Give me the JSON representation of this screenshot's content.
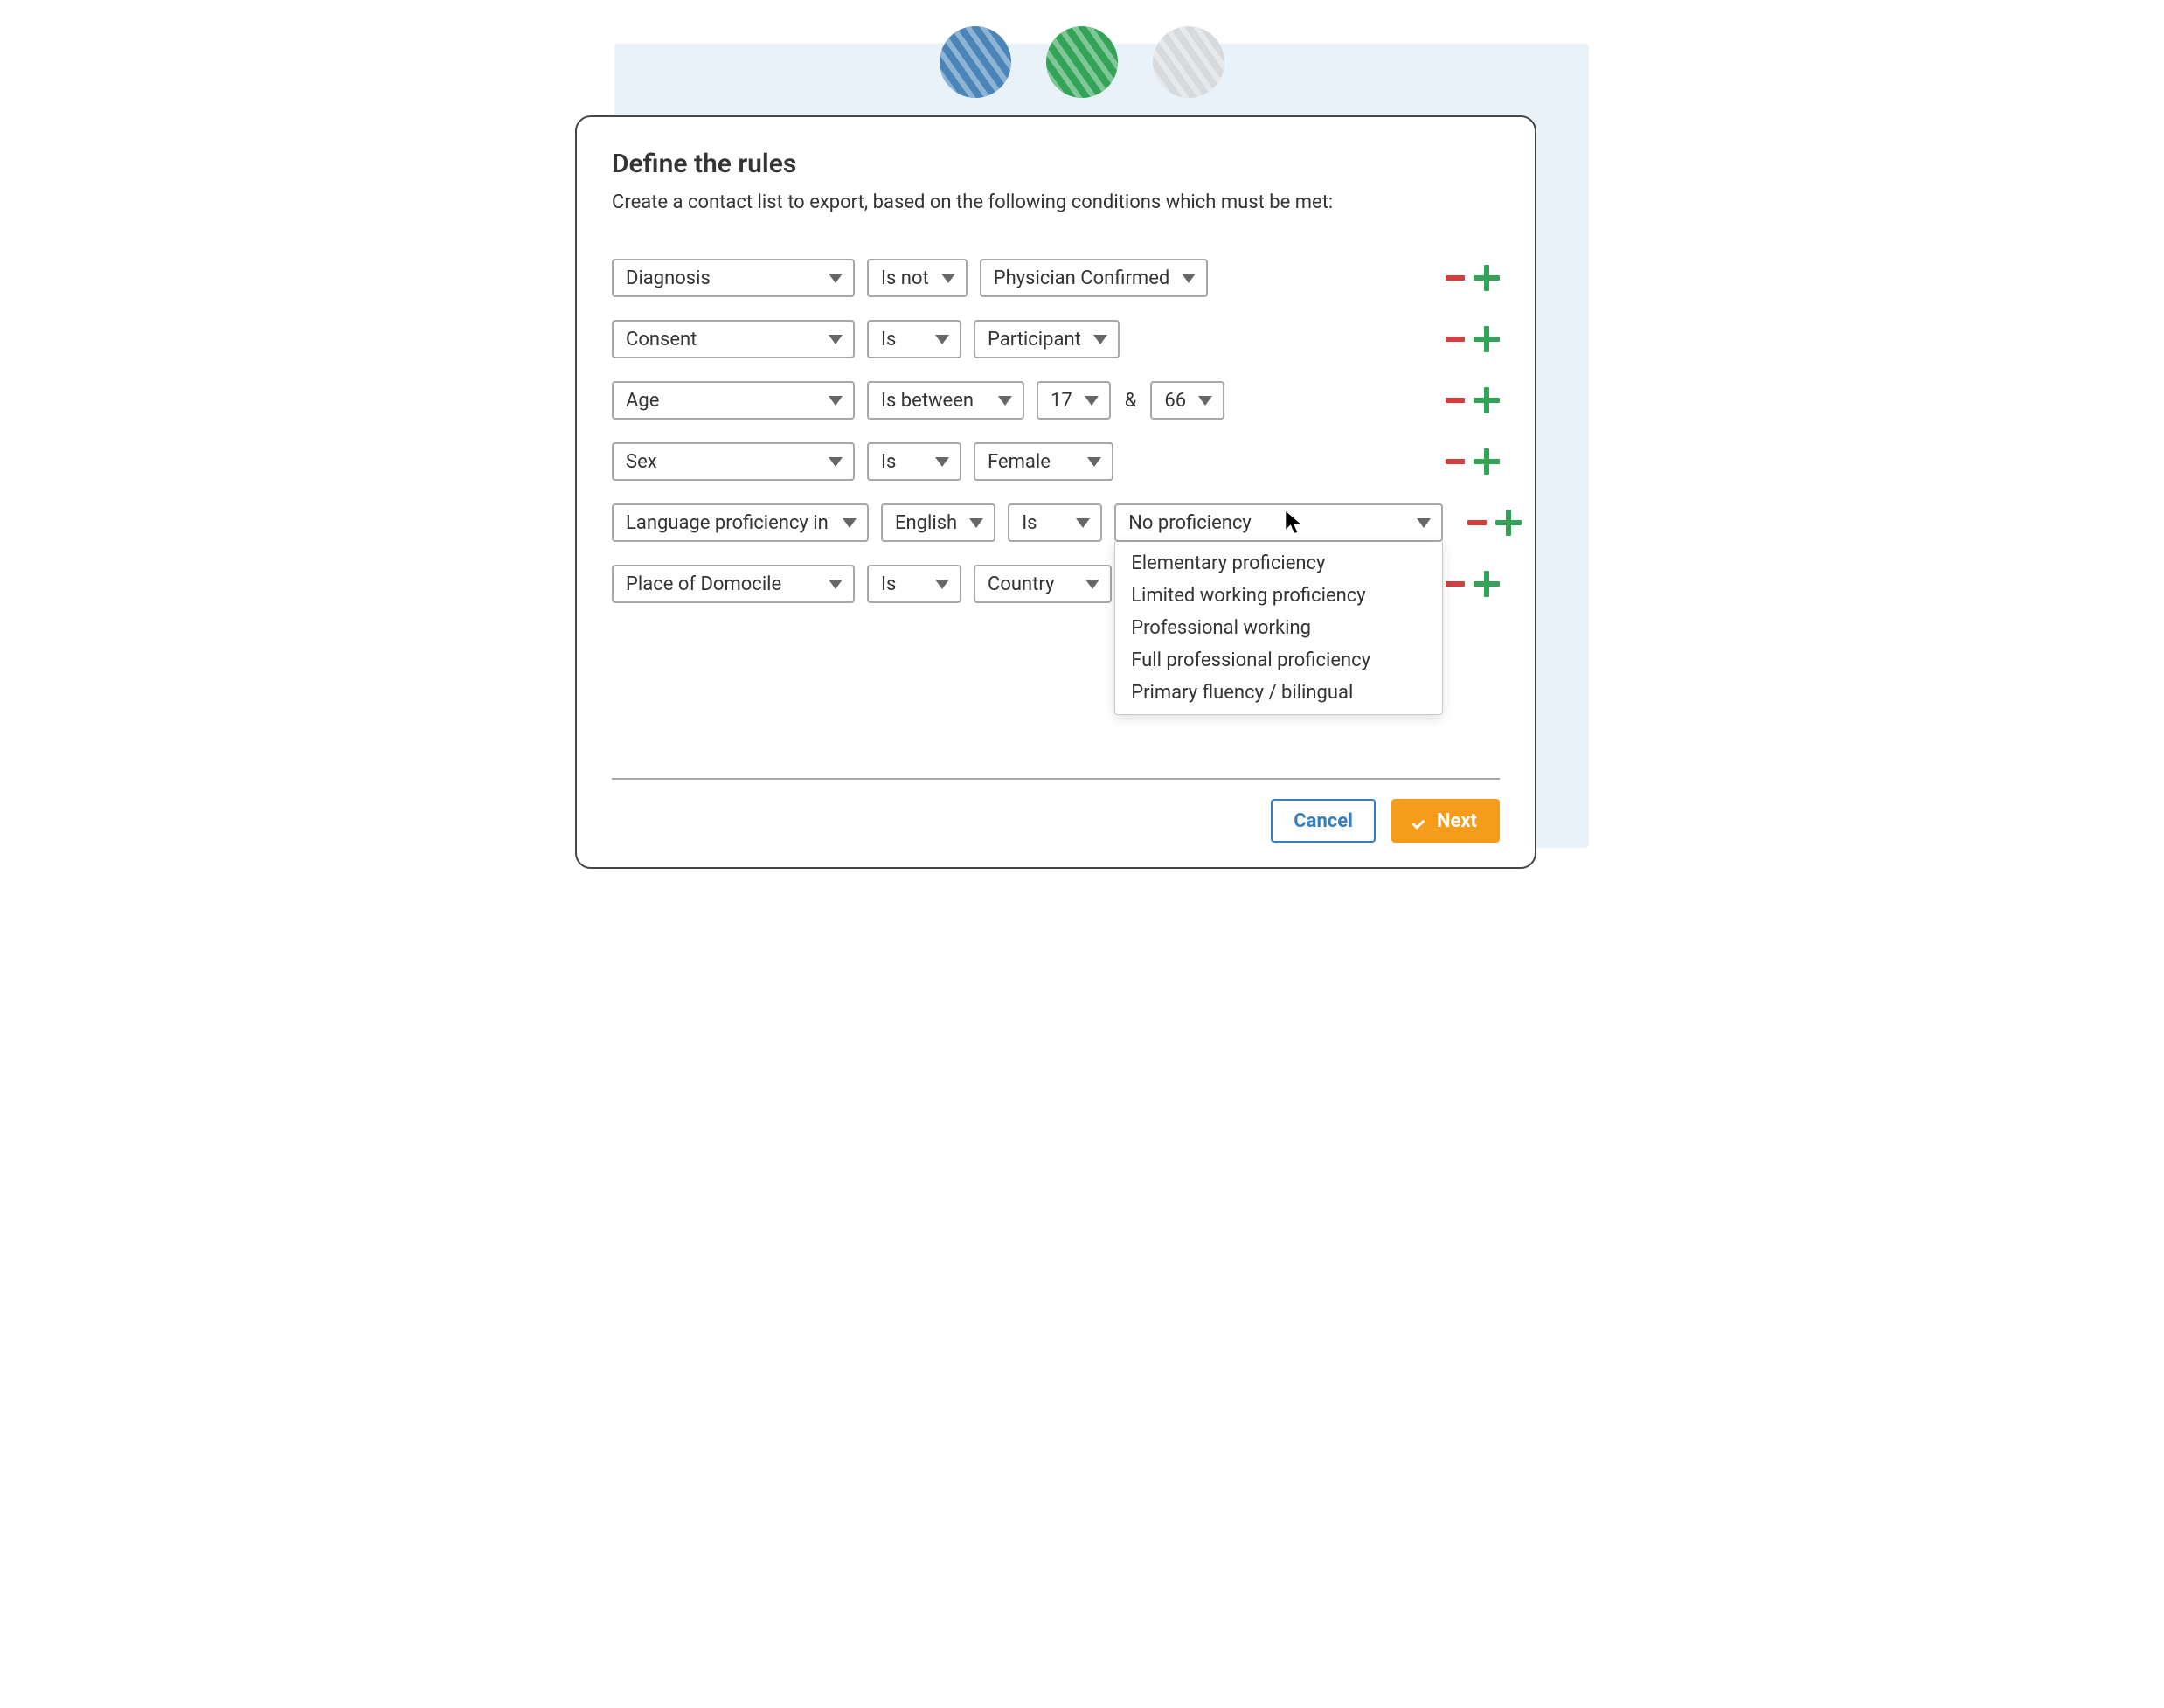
{
  "header": {
    "title": "Define the rules",
    "subtitle": "Create a contact list to export, based on the following conditions which must be met:"
  },
  "rules": [
    {
      "field": "Diagnosis",
      "operator": "Is not",
      "value1": "Physician Confirmed"
    },
    {
      "field": "Consent",
      "operator": "Is",
      "value1": "Participant"
    },
    {
      "field": "Age",
      "operator": "Is between",
      "value1": "17",
      "joiner": "&",
      "value2": "66"
    },
    {
      "field": "Sex",
      "operator": "Is",
      "value1": "Female"
    },
    {
      "field": "Language proficiency in",
      "lang": "English",
      "operator": "Is",
      "value1": "No proficiency"
    },
    {
      "field": "Place of Domocile",
      "operator": "Is",
      "value1": "Country"
    }
  ],
  "proficiency_options": [
    "Elementary proficiency",
    "Limited working proficiency",
    "Professional working",
    "Full professional proficiency",
    "Primary fluency / bilingual"
  ],
  "footer": {
    "cancel": "Cancel",
    "next": "Next"
  }
}
